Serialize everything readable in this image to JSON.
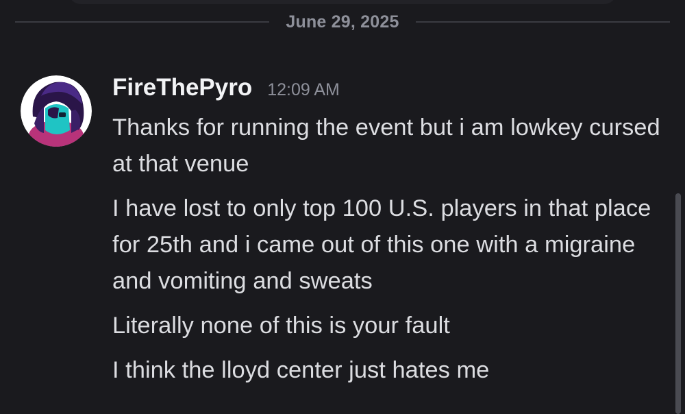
{
  "divider": {
    "date": "June 29, 2025"
  },
  "message": {
    "author": "FireThePyro",
    "time": "12:09 AM",
    "lines": [
      "Thanks for running the event but i am lowkey cursed at that venue",
      "I have lost to only top 100 U.S. players in that place for 25th and i came out of this one with a migraine and vomiting and sweats",
      "Literally none of this is your fault",
      "I think the lloyd center just hates me"
    ]
  },
  "colors": {
    "background": "#1a1a1e",
    "username": "#f2f3f5",
    "text": "#dcdde1",
    "muted": "#8e909a"
  }
}
